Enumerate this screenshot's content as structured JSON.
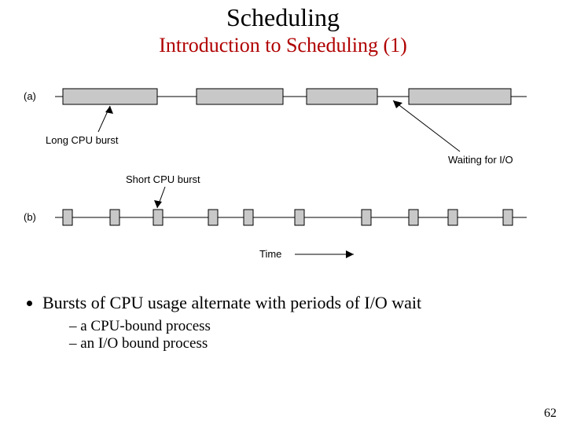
{
  "title": "Scheduling",
  "subtitle": "Introduction to Scheduling (1)",
  "diagram": {
    "row_a_label": "(a)",
    "row_b_label": "(b)",
    "long_burst_label": "Long CPU burst",
    "short_burst_label": "Short CPU burst",
    "waiting_io_label": "Waiting for I/O",
    "time_label": "Time"
  },
  "bullet_main": "Bursts of CPU usage alternate with periods of I/O wait",
  "sub_a": "a CPU-bound process",
  "sub_b": "an I/O bound process",
  "page_number": "62"
}
